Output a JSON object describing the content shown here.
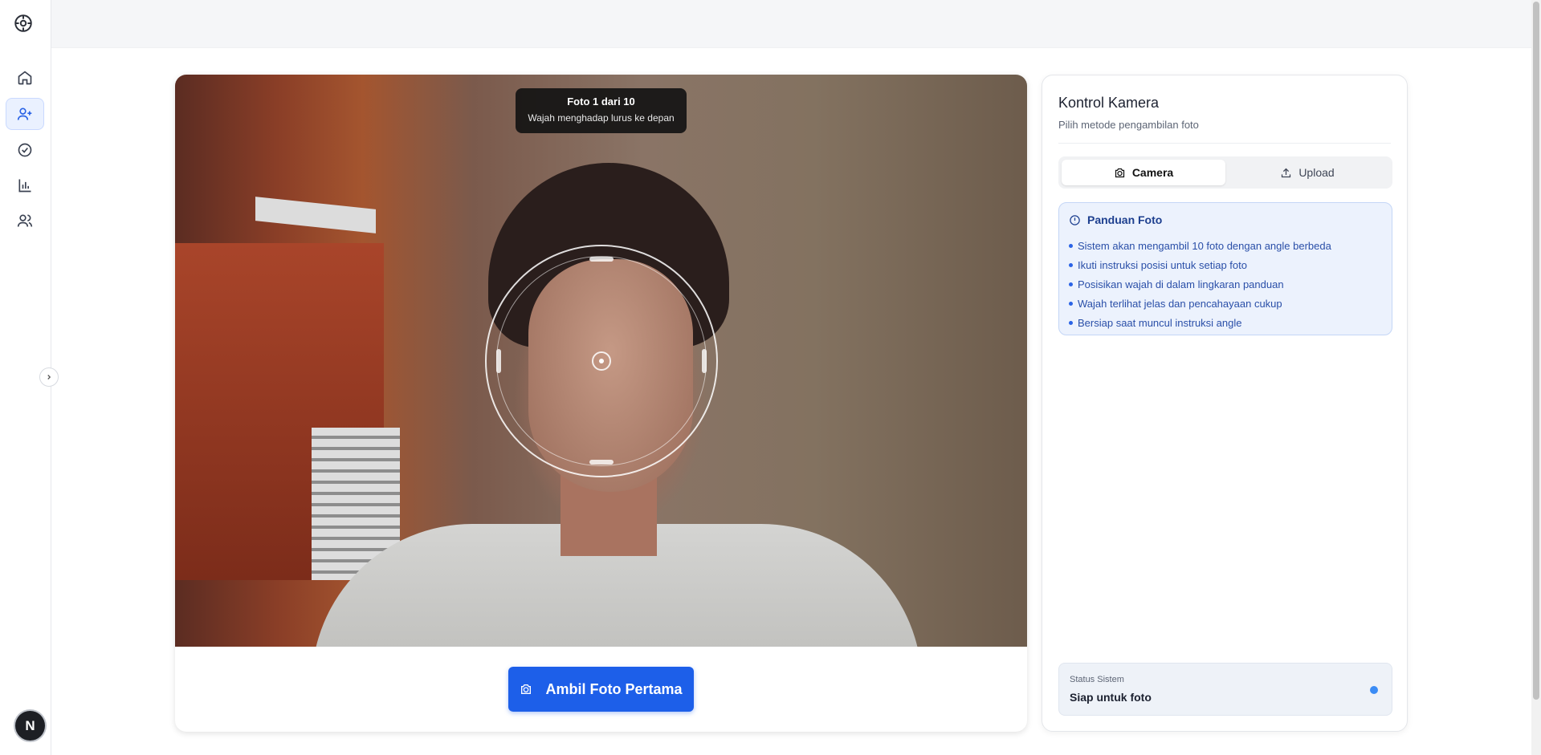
{
  "sidebar": {
    "logo_icon": "target-logo-icon",
    "items": [
      {
        "icon": "home-icon",
        "active": false
      },
      {
        "icon": "user-plus-icon",
        "active": true
      },
      {
        "icon": "check-circle-icon",
        "active": false
      },
      {
        "icon": "bar-chart-icon",
        "active": false
      },
      {
        "icon": "users-icon",
        "active": false
      }
    ],
    "toggle_icon": "chevron-right-icon",
    "avatar_initial": "N"
  },
  "camera": {
    "tooltip_title": "Foto 1 dari 10",
    "tooltip_subtitle": "Wajah menghadap lurus ke depan",
    "capture_label": "Ambil Foto Pertama",
    "capture_icon": "camera-icon"
  },
  "control": {
    "title": "Kontrol Kamera",
    "subtitle": "Pilih metode pengambilan foto",
    "tabs": [
      {
        "label": "Camera",
        "icon": "camera-icon",
        "active": true
      },
      {
        "label": "Upload",
        "icon": "upload-icon",
        "active": false
      }
    ],
    "guide": {
      "title": "Panduan Foto",
      "icon": "alert-circle-icon",
      "items": [
        "Sistem akan mengambil 10 foto dengan angle berbeda",
        "Ikuti instruksi posisi untuk setiap foto",
        "Posisikan wajah di dalam lingkaran panduan",
        "Wajah terlihat jelas dan pencahayaan cukup",
        "Bersiap saat muncul instruksi angle"
      ]
    },
    "status": {
      "label": "Status Sistem",
      "value": "Siap untuk foto",
      "dot_color": "#3b8cf5"
    }
  },
  "colors": {
    "accent": "#1d5fe9",
    "active_nav_bg": "#eaf1ff"
  }
}
